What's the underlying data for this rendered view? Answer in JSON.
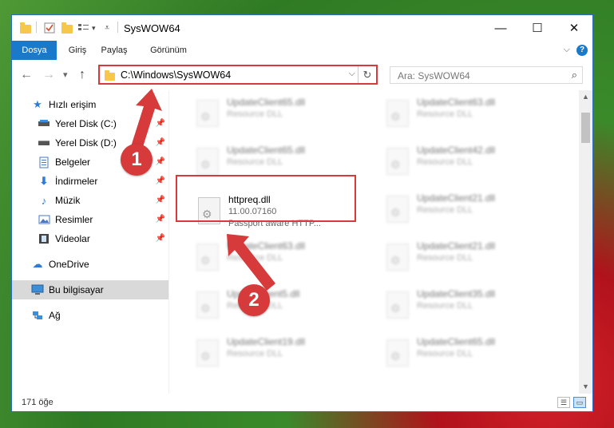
{
  "window": {
    "title": "SysWOW64",
    "controls": {
      "minimize": "—",
      "maximize": "☐",
      "close": "✕"
    }
  },
  "ribbon": {
    "tabs": [
      "Dosya",
      "Giriş",
      "Paylaş",
      "Görünüm"
    ],
    "help": "?"
  },
  "navbar": {
    "back": "←",
    "forward": "→",
    "recent": "▾",
    "up": "↑",
    "address": "C:\\Windows\\SysWOW64",
    "address_dropdown": "⌵",
    "refresh": "↻",
    "search_placeholder": "Ara: SysWOW64",
    "search_glyph": "⌕"
  },
  "sidebar": {
    "quick_access": "Hızlı erişim",
    "items": [
      {
        "label": "Yerel Disk (C:)",
        "icon": "drive-icon"
      },
      {
        "label": "Yerel Disk (D:)",
        "icon": "drive-icon"
      },
      {
        "label": "Belgeler",
        "icon": "documents-icon"
      },
      {
        "label": "İndirmeler",
        "icon": "downloads-icon"
      },
      {
        "label": "Müzik",
        "icon": "music-icon"
      },
      {
        "label": "Resimler",
        "icon": "pictures-icon"
      },
      {
        "label": "Videolar",
        "icon": "videos-icon"
      }
    ],
    "onedrive": "OneDrive",
    "this_pc": "Bu bilgisayar",
    "network": "Ağ"
  },
  "files": {
    "left_column": [
      {
        "name": "UpdateClient65.dll",
        "sub": "Resource DLL"
      },
      {
        "name": "UpdateClient65.dll",
        "sub": "Resource DLL"
      },
      {
        "name": "httpreq.dll",
        "version": "11.00.07160",
        "desc": "Passport aware HTTP..."
      },
      {
        "name": "UpdateClient63.dll",
        "sub": "Resource DLL"
      },
      {
        "name": "UpdateClient5.dll",
        "sub": "Resource DLL"
      },
      {
        "name": "UpdateClient19.dll",
        "sub": "Resource DLL"
      }
    ],
    "right_column": [
      {
        "name": "UpdateClient63.dll",
        "sub": "Resource DLL"
      },
      {
        "name": "UpdateClient42.dll",
        "sub": "Resource DLL"
      },
      {
        "name": "UpdateClient21.dll",
        "sub": "Resource DLL"
      },
      {
        "name": "UpdateClient21.dll",
        "sub": "Resource DLL"
      },
      {
        "name": "UpdateClient35.dll",
        "sub": "Resource DLL"
      },
      {
        "name": "UpdateClient65.dll",
        "sub": "Resource DLL"
      }
    ]
  },
  "status": {
    "item_count": "171 öğe"
  },
  "annotations": {
    "step1": "1",
    "step2": "2",
    "color": "#d63a3a"
  }
}
